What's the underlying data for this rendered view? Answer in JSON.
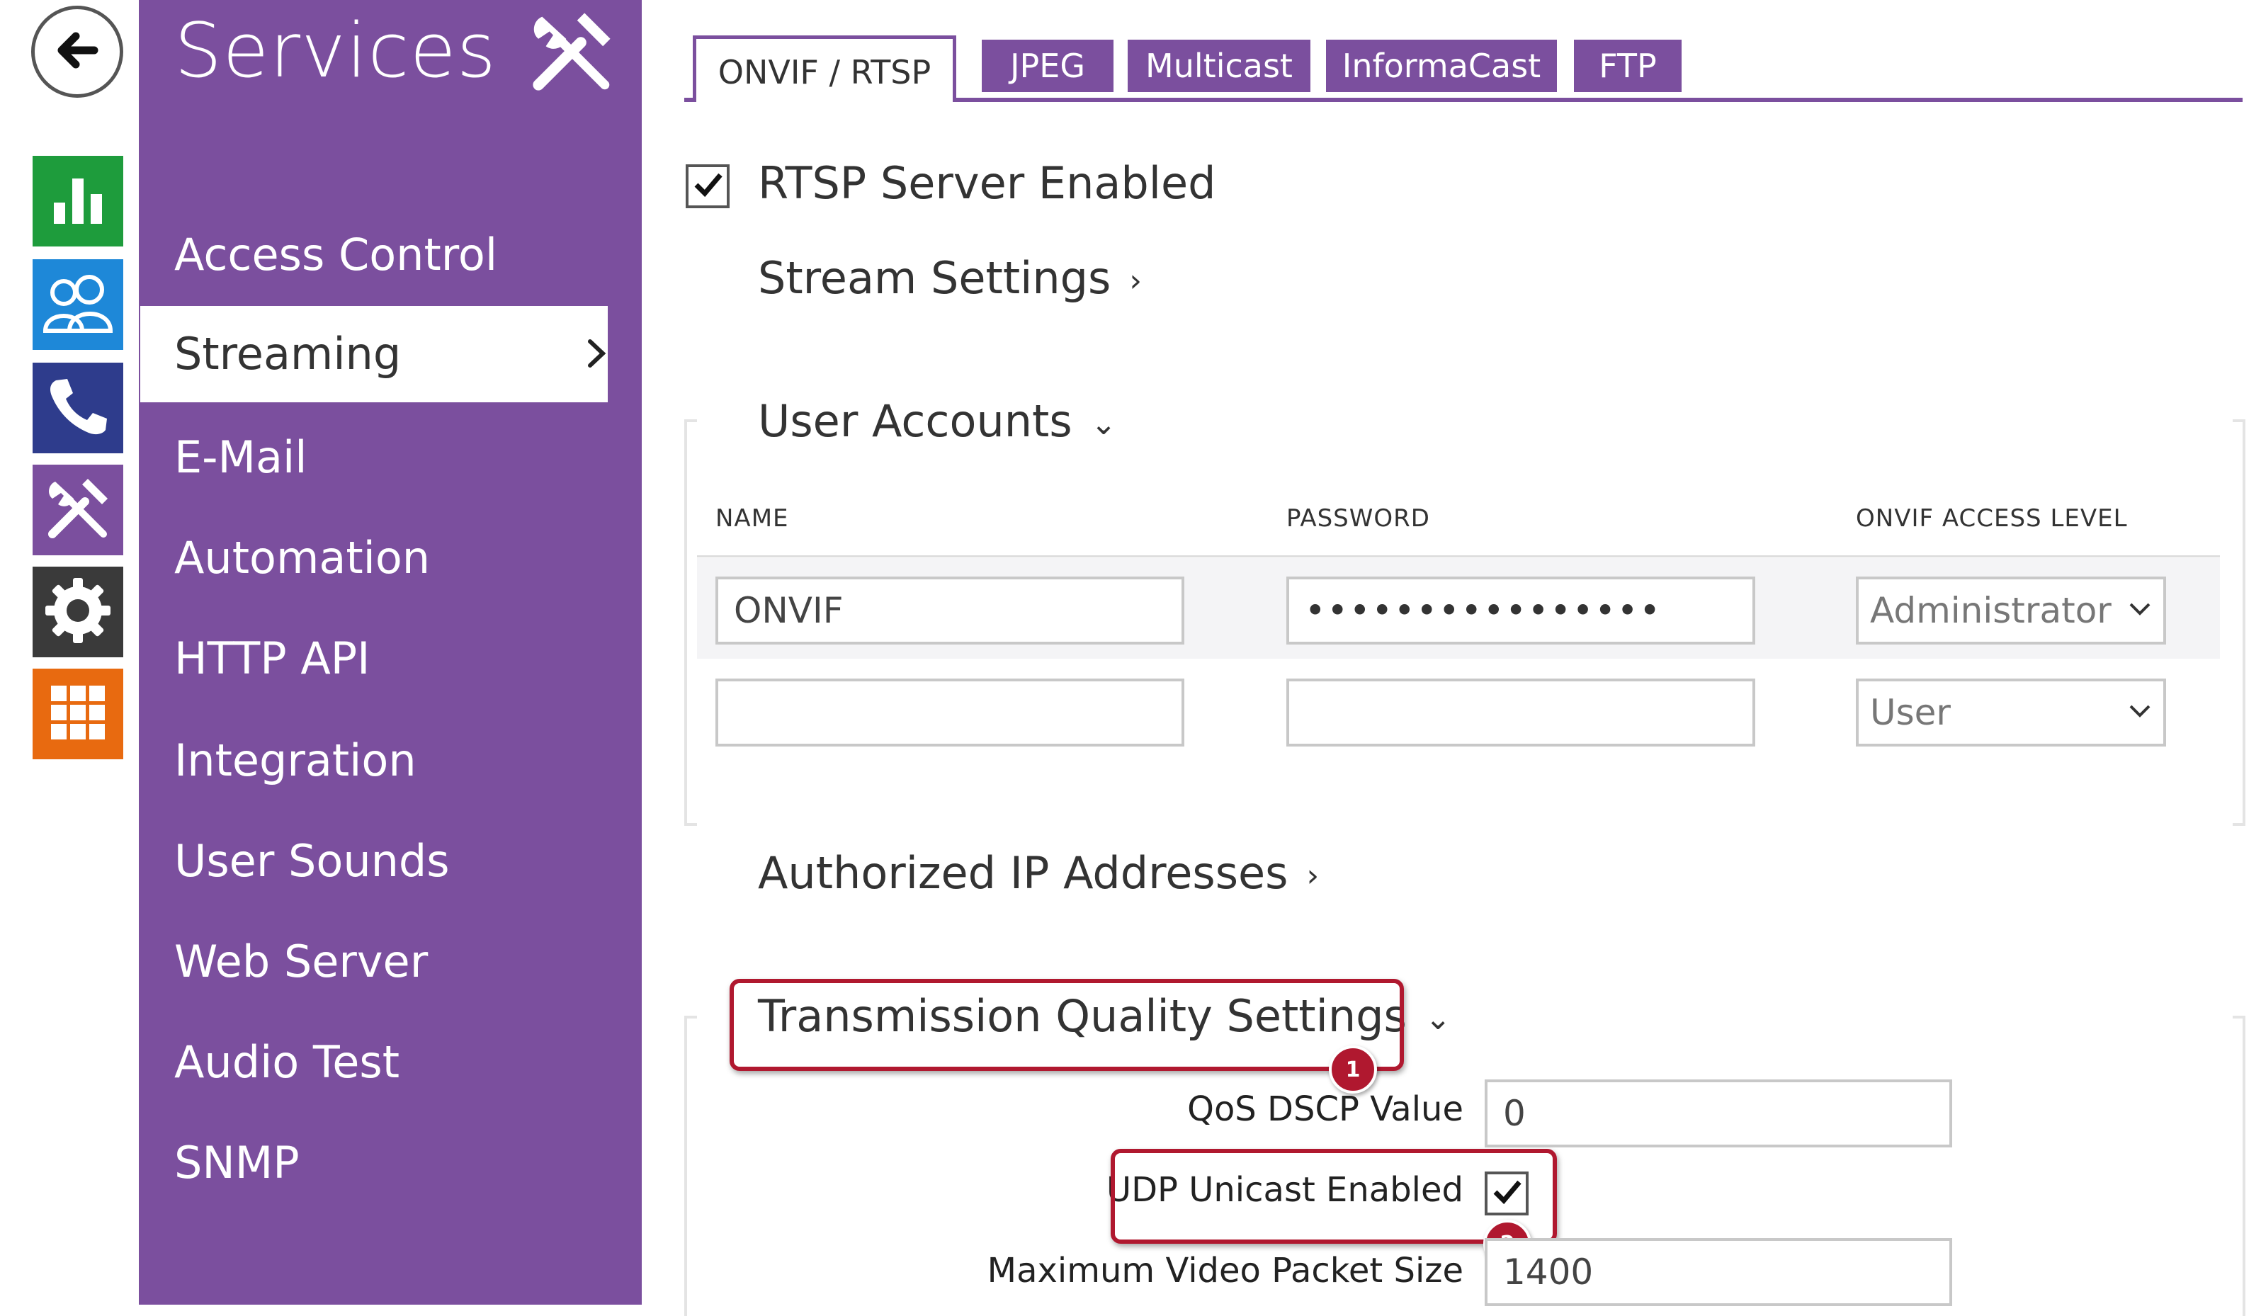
{
  "rail": {
    "back_icon": "arrow-left-icon",
    "items": [
      {
        "icon": "bar-chart-icon",
        "color": "#1e9c3c"
      },
      {
        "icon": "users-icon",
        "color": "#1e88d8"
      },
      {
        "icon": "phone-icon",
        "color": "#2e3c8c"
      },
      {
        "icon": "tools-icon",
        "color": "#7b4f9e"
      },
      {
        "icon": "gear-icon",
        "color": "#3a3a3a"
      },
      {
        "icon": "grid-icon",
        "color": "#e86a10"
      }
    ]
  },
  "sidebar": {
    "title": "Services",
    "title_icon": "tools-icon",
    "items": [
      {
        "label": "Access Control"
      },
      {
        "label": "Streaming",
        "active": true
      },
      {
        "label": "E-Mail"
      },
      {
        "label": "Automation"
      },
      {
        "label": "HTTP API"
      },
      {
        "label": "Integration"
      },
      {
        "label": "User Sounds"
      },
      {
        "label": "Web Server"
      },
      {
        "label": "Audio Test"
      },
      {
        "label": "SNMP"
      }
    ]
  },
  "tabs": [
    {
      "label": "ONVIF / RTSP",
      "active": true
    },
    {
      "label": "JPEG"
    },
    {
      "label": "Multicast"
    },
    {
      "label": "InformaCast"
    },
    {
      "label": "FTP"
    }
  ],
  "rtsp": {
    "label": "RTSP Server Enabled",
    "checked": true
  },
  "sections": {
    "stream_settings": "Stream Settings",
    "user_accounts": "User Accounts",
    "authorized_ip": "Authorized IP Addresses",
    "transmission_quality": "Transmission Quality Settings"
  },
  "user_table": {
    "headers": [
      "NAME",
      "PASSWORD",
      "ONVIF ACCESS LEVEL"
    ],
    "rows": [
      {
        "name": "ONVIF",
        "password": "••••••••••••••••",
        "access_level": "Administrator"
      },
      {
        "name": "",
        "password": "",
        "access_level": "User"
      }
    ]
  },
  "transmission": {
    "qos_label": "QoS DSCP Value",
    "qos_value": "0",
    "udp_label": "UDP Unicast Enabled",
    "udp_checked": true,
    "max_packet_label": "Maximum Video Packet Size",
    "max_packet_value": "1400"
  },
  "callouts": [
    "1",
    "2"
  ],
  "colors": {
    "brand_purple": "#7b4f9e",
    "highlight_red": "#b0182f"
  }
}
